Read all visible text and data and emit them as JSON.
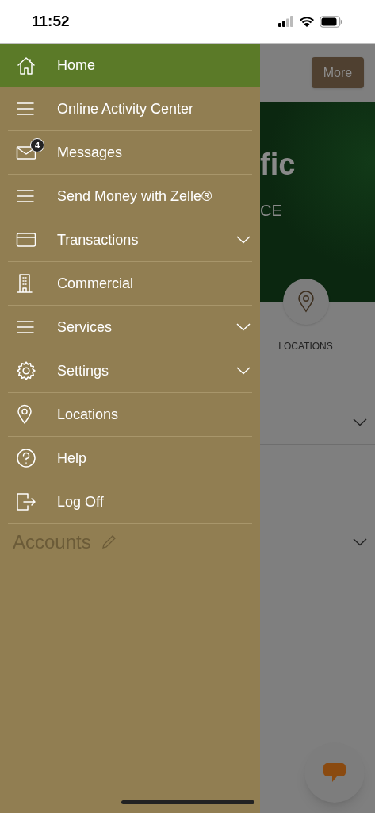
{
  "status_bar": {
    "time": "11:52"
  },
  "drawer": {
    "items": [
      {
        "label": "Home",
        "kind": "home",
        "selected": true
      },
      {
        "label": "Online Activity Center",
        "kind": "lines",
        "selected": false
      },
      {
        "label": "Messages",
        "kind": "mail",
        "selected": false,
        "badge": "4"
      },
      {
        "label": "Send Money with Zelle®",
        "kind": "lines",
        "selected": false
      },
      {
        "label": "Transactions",
        "kind": "card",
        "selected": false,
        "expanded": false
      },
      {
        "label": "Commercial",
        "kind": "building",
        "selected": false
      },
      {
        "label": "Services",
        "kind": "lines",
        "selected": false,
        "expanded": false
      },
      {
        "label": "Settings",
        "kind": "gear",
        "selected": false,
        "expanded": false
      },
      {
        "label": "Locations",
        "kind": "pin",
        "selected": false
      },
      {
        "label": "Help",
        "kind": "help",
        "selected": false
      },
      {
        "label": "Log Off",
        "kind": "logout",
        "selected": false
      }
    ],
    "faded_heading": "Accounts"
  },
  "page": {
    "more_button": "More",
    "banner_title": "fic",
    "banner_subtitle": "CE",
    "locations_label": "LOCATIONS",
    "sections": [
      {
        "expanded": false
      },
      {
        "expanded": false
      }
    ]
  }
}
